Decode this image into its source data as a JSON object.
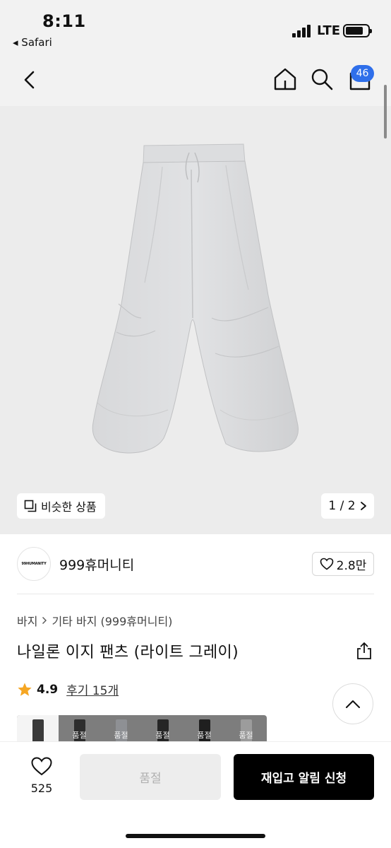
{
  "status_bar": {
    "time": "8:11",
    "back_app": "◂ Safari",
    "network": "LTE"
  },
  "nav": {
    "cart_count": "46",
    "icons": [
      "chevron-left-icon",
      "home-icon",
      "search-icon",
      "shopping-bag-icon"
    ]
  },
  "gallery": {
    "similar_label": "비슷한 상품",
    "page_indicator": "1 / 2"
  },
  "brand": {
    "logo_text": "99HUMANITY",
    "name": "999휴머니티",
    "likes": "2.8만"
  },
  "product": {
    "breadcrumb": [
      "바지",
      "기타 바지 (999휴머니티)"
    ],
    "title": "나일론 이지 팬츠 (라이트 그레이)",
    "rating": "4.9",
    "reviews": "후기 15개"
  },
  "swatches": [
    {
      "color": "#3a3a3a",
      "label": ""
    },
    {
      "color": "#2d2d2d",
      "label": "품절"
    },
    {
      "color": "#8e9094",
      "label": "품절"
    },
    {
      "color": "#262626",
      "label": "품절"
    },
    {
      "color": "#1f1f1f",
      "label": "품절"
    },
    {
      "color": "#9c9c9c",
      "label": "품절"
    }
  ],
  "bottom_bar": {
    "wish_count": "525",
    "soldout_label": "품절",
    "restock_label": "재입고 알림 신청"
  },
  "colors": {
    "accent_blue": "#2f6fea",
    "primary_button": "#000000",
    "disabled_button": "#ededed"
  }
}
